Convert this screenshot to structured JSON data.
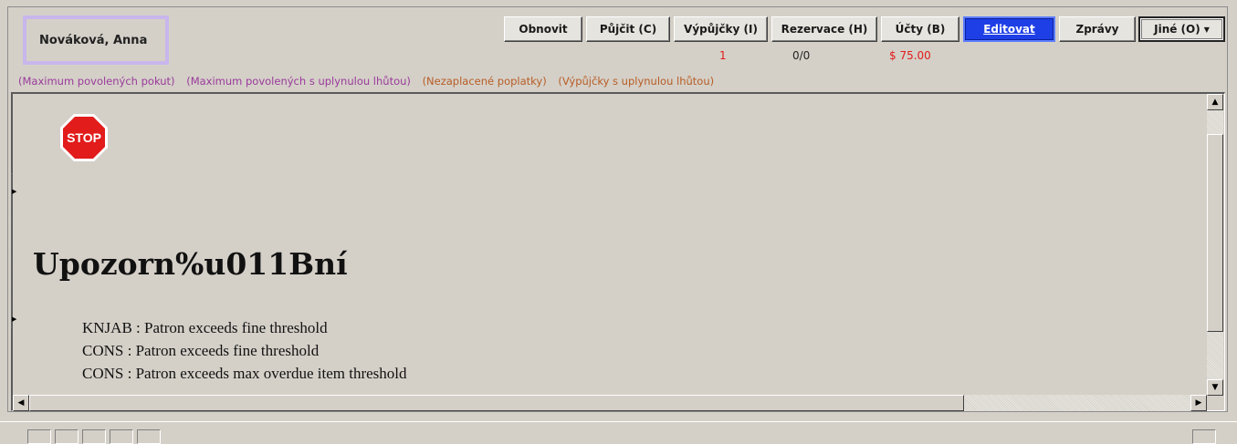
{
  "patron": {
    "name": "Nováková, Anna"
  },
  "toolbar": {
    "buttons": [
      {
        "label": "Obnovit"
      },
      {
        "label": "Půjčit (C)"
      },
      {
        "label": "Výpůjčky (I)"
      },
      {
        "label": "Rezervace (H)"
      },
      {
        "label": "Účty (B)"
      },
      {
        "label": "Editovat"
      },
      {
        "label": "Zprávy"
      },
      {
        "label": "Jiné (O)"
      }
    ],
    "counts": {
      "loans": "1",
      "holds": "0/0",
      "bills": "$ 75.00"
    }
  },
  "legend": [
    {
      "text": "(Maximum povolených pokut)",
      "color": "#9b3a9b"
    },
    {
      "text": "(Maximum povolených  s uplynulou lhůtou)",
      "color": "#9b3a9b"
    },
    {
      "text": "(Nezaplacené poplatky)",
      "color": "#b85c24"
    },
    {
      "text": "(Výpůjčky s uplynulou lhůtou)",
      "color": "#b85c24"
    }
  ],
  "alert": {
    "icon_text": "STOP",
    "heading": "Upozorn%u011Bní",
    "lines": [
      "KNJAB : Patron exceeds fine threshold",
      "CONS : Patron exceeds fine threshold",
      "CONS : Patron exceeds max overdue item threshold"
    ]
  },
  "colors": {
    "accent": "#1e3fe6",
    "alert_red": "#e21b1b",
    "name_box_border": "#c8b6ec"
  }
}
